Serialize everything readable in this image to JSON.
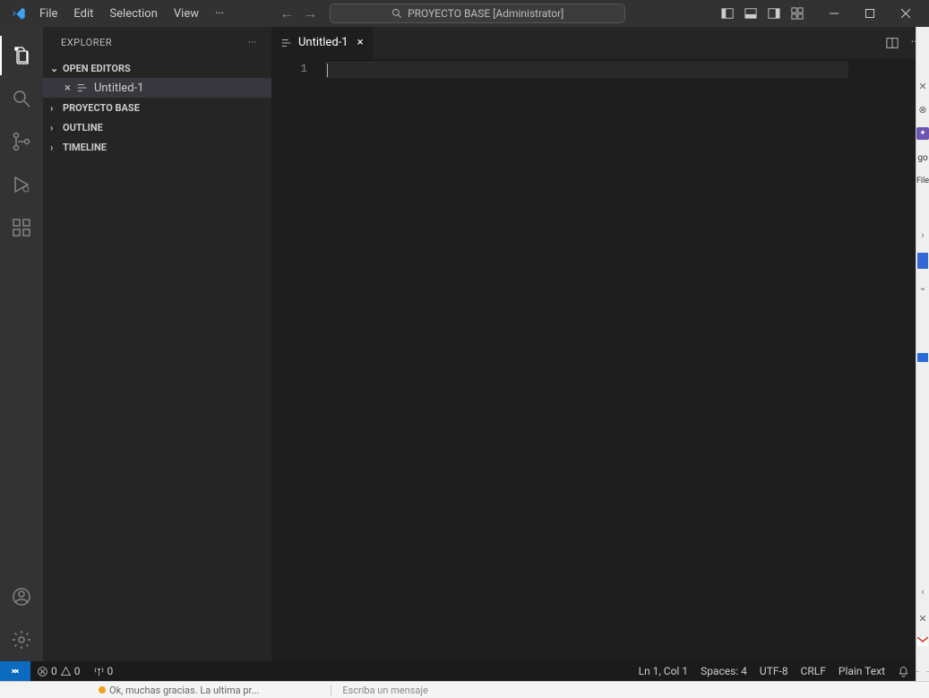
{
  "titlebar": {
    "menu": [
      "File",
      "Edit",
      "Selection",
      "View"
    ],
    "search_text": "PROYECTO BASE [Administrator]"
  },
  "sidebar": {
    "title": "EXPLORER",
    "sections": {
      "open_editors": "OPEN EDITORS",
      "project": "PROYECTO BASE",
      "outline": "OUTLINE",
      "timeline": "TIMELINE"
    },
    "open_editor_item": "Untitled-1"
  },
  "editor": {
    "tab_label": "Untitled-1",
    "line_number": "1"
  },
  "statusbar": {
    "errors": "0",
    "warnings": "0",
    "ports": "0",
    "cursor": "Ln 1, Col 1",
    "spaces": "Spaces: 4",
    "encoding": "UTF-8",
    "eol": "CRLF",
    "lang": "Plain Text"
  },
  "bottom": {
    "prev_msg": "Ok, muchas gracias. La ultima pr...",
    "input_placeholder": "Escriba un mensaje"
  },
  "right_edge": {
    "text1": "go",
    "text2": "File"
  }
}
